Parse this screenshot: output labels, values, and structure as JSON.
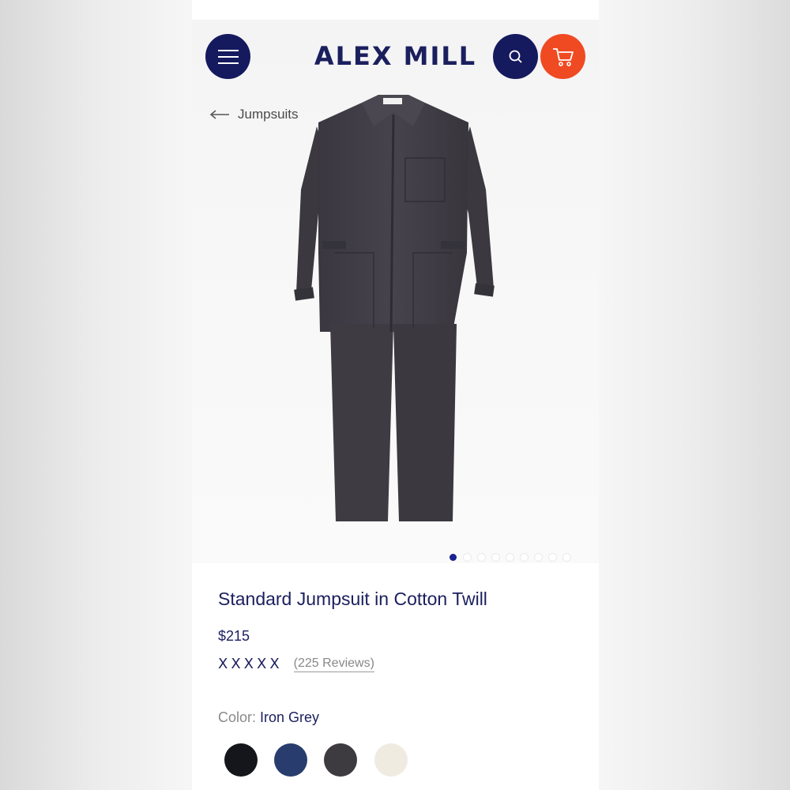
{
  "header": {
    "logo_text": "ALEX MILL",
    "menu_icon": "hamburger-menu-icon",
    "search_icon": "search-icon",
    "cart_icon": "cart-icon",
    "colors": {
      "navy": "#15195e",
      "orange": "#f04a23"
    }
  },
  "breadcrumb": {
    "back_label": "Jumpsuits",
    "icon": "arrow-left-icon"
  },
  "gallery": {
    "slide_count": 9,
    "active_index": 0
  },
  "product": {
    "title": "Standard Jumpsuit in Cotton Twill",
    "price": "$215",
    "rating_marks": "XXXXX",
    "reviews": "(225 Reviews)",
    "color_label": "Color:",
    "color_value": "Iron Grey",
    "swatches": [
      {
        "name": "Black",
        "hex": "#15161b",
        "selected": false
      },
      {
        "name": "Navy",
        "hex": "#283d6e",
        "selected": false
      },
      {
        "name": "Iron Grey",
        "hex": "#3d3a40",
        "selected": true
      },
      {
        "name": "Natural",
        "hex": "#efebe1",
        "selected": false
      }
    ]
  }
}
